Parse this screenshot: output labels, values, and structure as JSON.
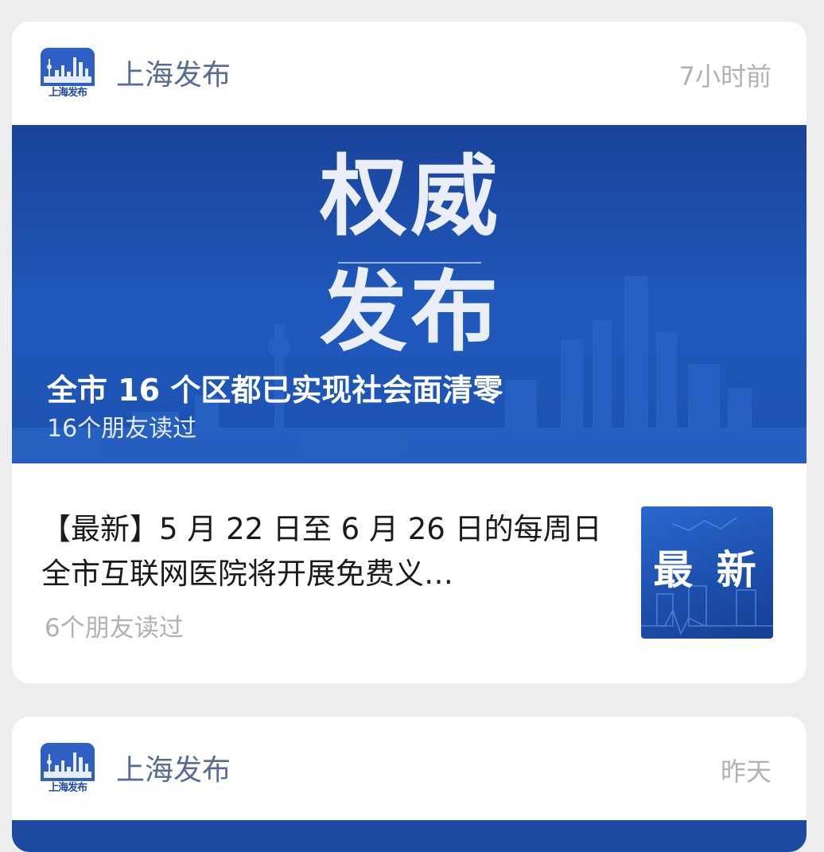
{
  "feed": {
    "cards": [
      {
        "account_name": "上海发布",
        "avatar_label": "上海发布",
        "time": "7小时前",
        "banner": {
          "big_text_line1": "权威",
          "big_text_line2": "发布",
          "title": "全市 16 个区都已实现社会面清零",
          "reads": "16个朋友读过"
        },
        "article": {
          "title": "【最新】5 月 22 日至 6 月 26 日的每周日全市互联网医院将开展免费义…",
          "reads": "6个朋友读过",
          "thumb_text": "最 新"
        }
      },
      {
        "account_name": "上海发布",
        "avatar_label": "上海发布",
        "time": "昨天"
      }
    ]
  },
  "colors": {
    "background": "#ededed",
    "card": "#ffffff",
    "account_name": "#576b95",
    "muted": "#b2b2b2",
    "banner_blue": "#1e56b6"
  }
}
